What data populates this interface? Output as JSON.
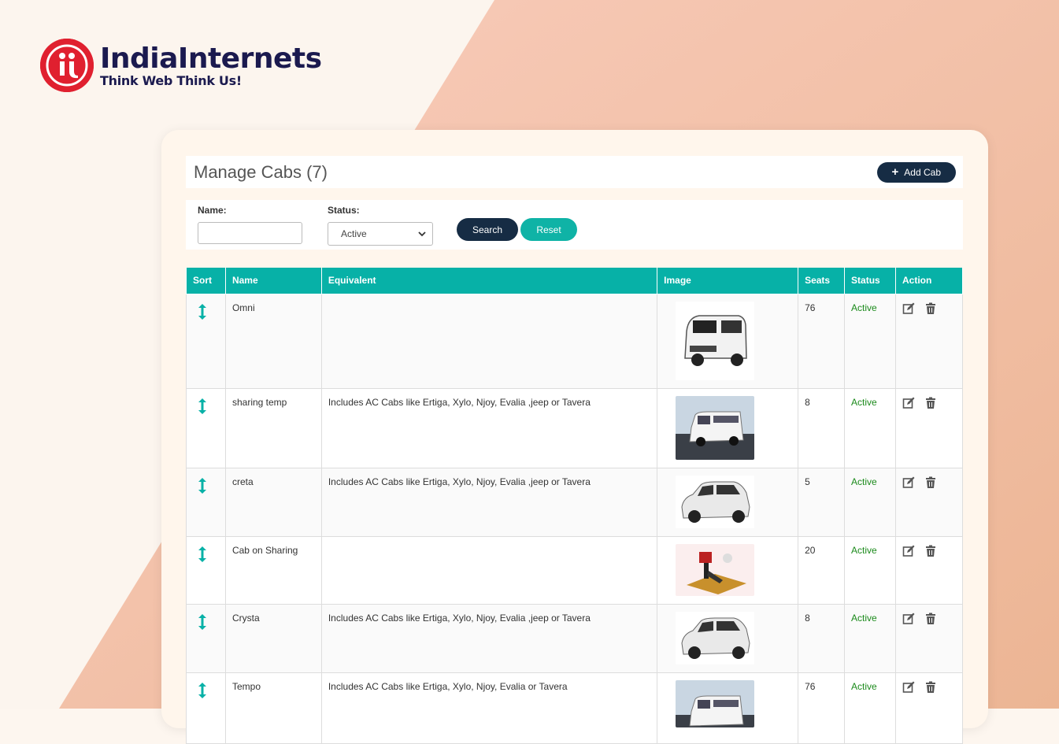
{
  "brand": {
    "name": "IndiaInternets",
    "tagline": "Think Web Think Us!",
    "color": "#e0202f",
    "text_color": "#1b1a4f"
  },
  "page": {
    "title": "Manage Cabs (7)",
    "add_label": "Add Cab"
  },
  "filters": {
    "name_label": "Name:",
    "name_value": "",
    "status_label": "Status:",
    "status_value": "Active",
    "search_label": "Search",
    "reset_label": "Reset"
  },
  "table": {
    "headers": {
      "sort": "Sort",
      "name": "Name",
      "equivalent": "Equivalent",
      "image": "Image",
      "seats": "Seats",
      "status": "Status",
      "action": "Action"
    },
    "rows": [
      {
        "name": "Omni",
        "equivalent": "",
        "seats": "76",
        "status": "Active",
        "image_icon": "white-van-image"
      },
      {
        "name": "sharing temp",
        "equivalent": "Includes AC Cabs like Ertiga, Xylo, Njoy, Evalia ,jeep or Tavera",
        "seats": "8",
        "status": "Active",
        "image_icon": "tempo-van-image"
      },
      {
        "name": "creta",
        "equivalent": "Includes AC Cabs like Ertiga, Xylo, Njoy, Evalia ,jeep or Tavera",
        "seats": "5",
        "status": "Active",
        "image_icon": "suv-image"
      },
      {
        "name": "Cab on Sharing",
        "equivalent": "",
        "seats": "20",
        "status": "Active",
        "image_icon": "toy-figure-image"
      },
      {
        "name": "Crysta",
        "equivalent": "Includes AC Cabs like Ertiga, Xylo, Njoy, Evalia ,jeep or Tavera",
        "seats": "8",
        "status": "Active",
        "image_icon": "suv-image"
      },
      {
        "name": "Tempo",
        "equivalent": "Includes AC Cabs like Ertiga, Xylo, Njoy, Evalia or Tavera",
        "seats": "76",
        "status": "Active",
        "image_icon": "tempo-van-image"
      }
    ]
  },
  "colors": {
    "accent": "#07b1a7",
    "dark_button": "#162c44",
    "status_active": "#1b8a1b"
  }
}
